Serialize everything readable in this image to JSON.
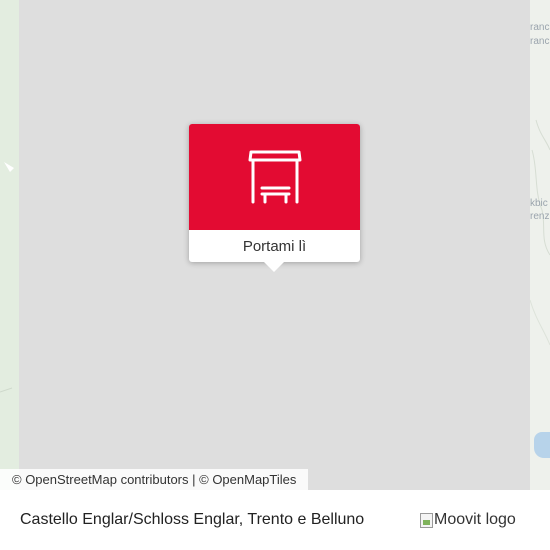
{
  "map": {
    "right_edge_labels": [
      "ranc",
      "ranc",
      "kbic",
      "renz"
    ],
    "colors": {
      "map_background": "#dedede",
      "forest_edge": "#e3ede0",
      "water": "#b7d3ea",
      "accent": "#e30b32"
    }
  },
  "popup": {
    "icon": "bus-stop-shelter-icon",
    "button_label": "Portami lì"
  },
  "attribution": {
    "osm_link": "© OpenStreetMap contributors",
    "separator": "|",
    "omt_link": "© OpenMapTiles"
  },
  "footer": {
    "stop_name": "Castello Englar/Schloss Englar, Trento e Belluno",
    "logo_alt": "Moovit logo"
  }
}
